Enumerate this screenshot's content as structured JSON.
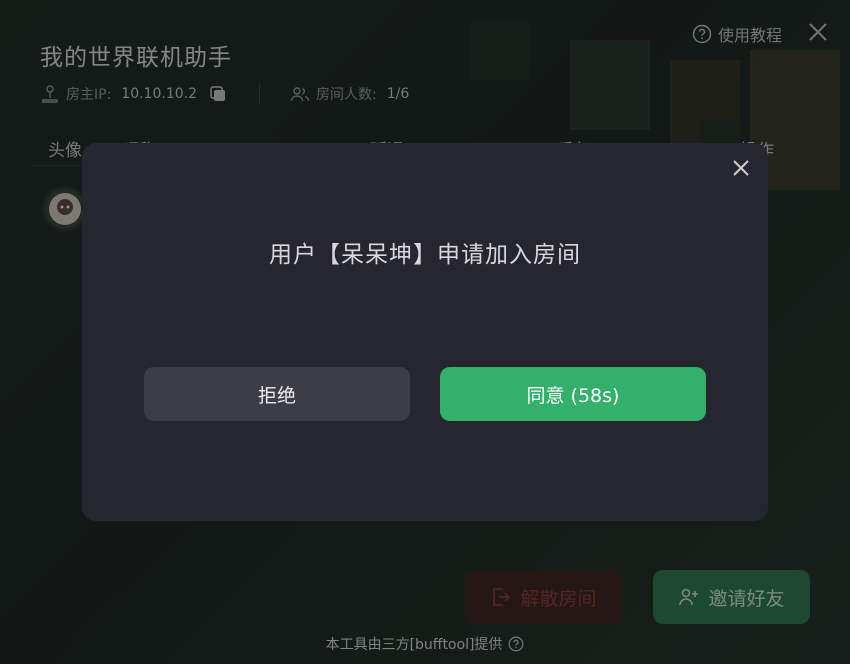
{
  "app": {
    "title": "我的世界联机助手",
    "help_label": "使用教程"
  },
  "info": {
    "host_ip_label": "房主IP:",
    "host_ip_value": "10.10.10.2",
    "room_count_label": "房间人数:",
    "room_count_value": "1/6"
  },
  "table": {
    "columns": [
      "头像",
      "昵称",
      "延迟",
      "丢包",
      "操作"
    ]
  },
  "footer": {
    "dissolve_label": "解散房间",
    "invite_label": "邀请好友",
    "note": "本工具由三方[bufftool]提供"
  },
  "modal": {
    "message": "用户【呆呆坤】申请加入房间",
    "reject_label": "拒绝",
    "agree_label": "同意 (58s)"
  },
  "colors": {
    "accent_green": "#33b06a",
    "invite_green": "#2a7a4e",
    "danger_red": "#8e3a3a",
    "modal_bg": "#262630"
  },
  "icons": {
    "help": "question-circle-icon",
    "close": "close-icon",
    "host": "joystick-icon",
    "copy": "copy-icon",
    "users": "users-icon",
    "dissolve": "exit-icon",
    "invite": "add-user-icon"
  }
}
